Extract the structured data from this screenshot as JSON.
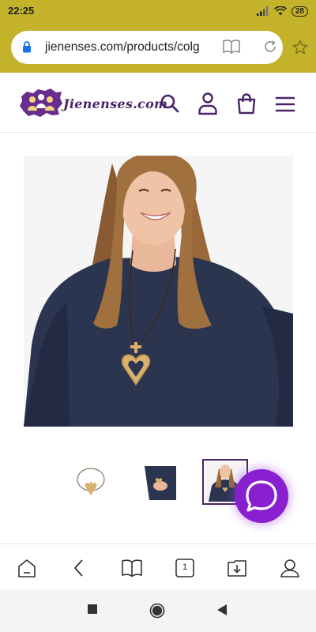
{
  "status": {
    "time": "22:25",
    "battery": "28"
  },
  "browser": {
    "url": "jienenses.com/products/colg",
    "tab_count": "1",
    "icons": [
      "lock-icon",
      "reader-mode-icon",
      "reload-icon",
      "star-icon"
    ]
  },
  "header": {
    "logo_text": "Jienenses.com",
    "icons": [
      "search-icon",
      "account-icon",
      "cart-icon",
      "menu-icon"
    ]
  },
  "product": {
    "image_alt": "woman wearing a wooden heart and cross pendant necklace",
    "thumbnails": [
      "necklace-thumbnail",
      "hand-holding-necklace-thumbnail",
      "woman-wearing-necklace-thumbnail"
    ],
    "selected_thumbnail": 3
  },
  "bottom_bar": {
    "icons": [
      "home-icon",
      "back-icon",
      "bookmarks-icon",
      "tabs-icon",
      "downloads-icon",
      "profile-icon"
    ]
  },
  "colors": {
    "browser_chrome": "#c4b32a",
    "brand": "#4a2366",
    "chat": "#8a1fd0"
  }
}
